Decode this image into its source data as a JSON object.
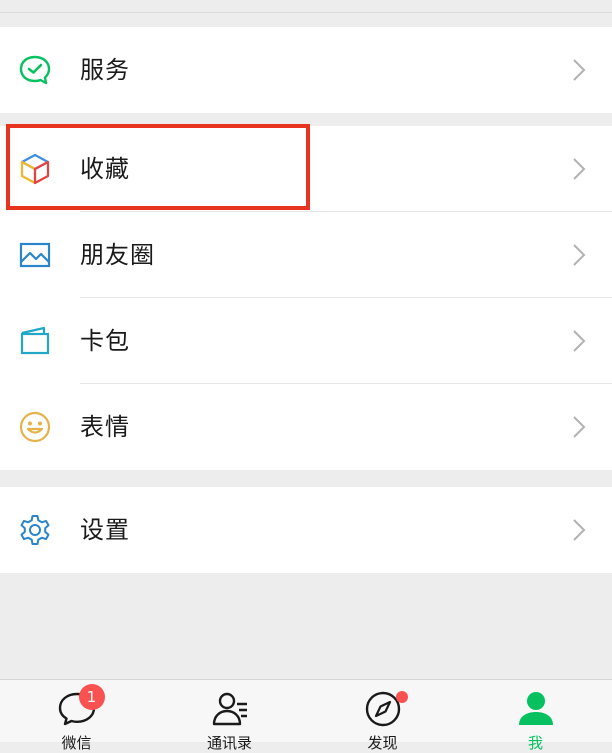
{
  "menu": {
    "group1": [
      {
        "label": "服务",
        "icon": "service-icon"
      }
    ],
    "group2": [
      {
        "label": "收藏",
        "icon": "favorites-cube-icon"
      },
      {
        "label": "朋友圈",
        "icon": "moments-image-icon"
      },
      {
        "label": "卡包",
        "icon": "card-wallet-icon"
      },
      {
        "label": "表情",
        "icon": "sticker-smiley-icon"
      }
    ],
    "group3": [
      {
        "label": "设置",
        "icon": "settings-gear-icon"
      }
    ]
  },
  "tabbar": {
    "tabs": [
      {
        "label": "微信",
        "icon": "chat-bubble-icon",
        "badge": "1"
      },
      {
        "label": "通讯录",
        "icon": "contacts-icon"
      },
      {
        "label": "发现",
        "icon": "discover-compass-icon",
        "dot": true
      },
      {
        "label": "我",
        "icon": "me-person-icon",
        "active": true
      }
    ]
  },
  "colors": {
    "accent": "#07c160",
    "highlight": "#e8331f",
    "badge": "#fa5151",
    "background": "#ededed"
  }
}
